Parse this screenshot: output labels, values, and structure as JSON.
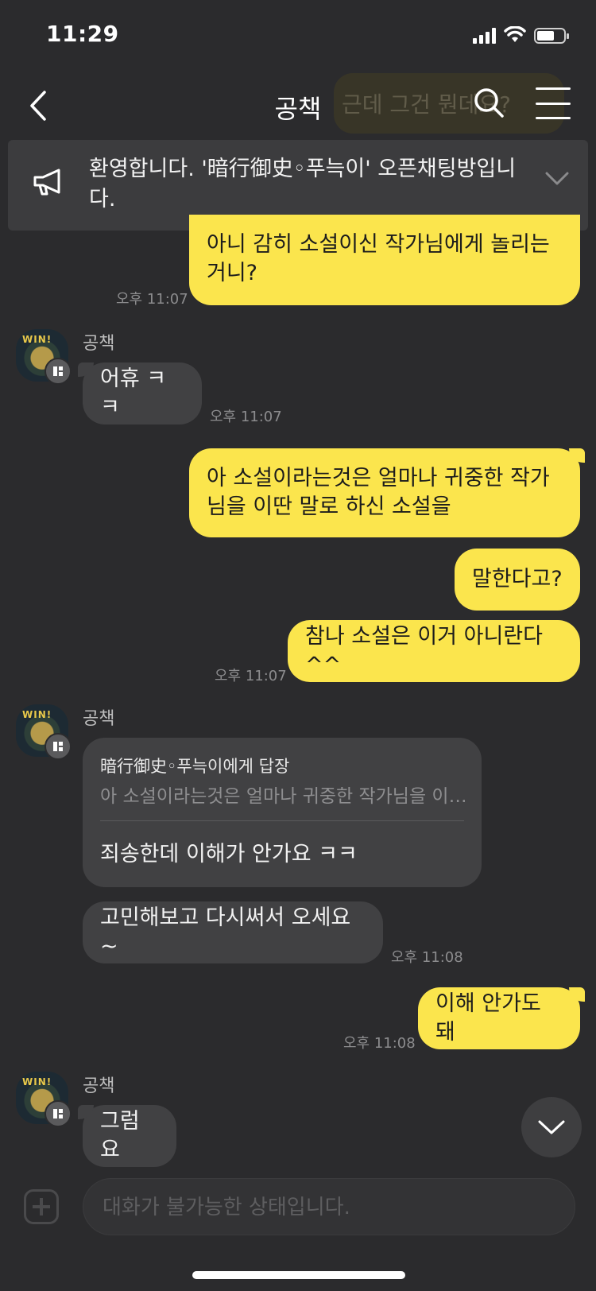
{
  "status_bar": {
    "time": "11:29",
    "battery_level": 0.65
  },
  "header": {
    "title": "공책",
    "ghost_preview": "근데 그건 뭔데요?"
  },
  "notice": {
    "text": "환영합니다. '暗行御史◦푸늑이' 오픈채팅방입니다."
  },
  "messages": {
    "m1": {
      "text": "아니 감히 소설이신 작가님에게 놀리는거니?",
      "time": "오후 11:07"
    },
    "m2": {
      "sender": "공책",
      "text": "어휴 ㅋㅋ",
      "time": "오후 11:07"
    },
    "m3": {
      "text": "아 소설이라는것은 얼마나 귀중한 작가님을 이딴 말로 하신 소설을"
    },
    "m4": {
      "text": "말한다고?"
    },
    "m5": {
      "text": "참나 소설은 이거 아니란다^^",
      "time": "오후 11:07"
    },
    "m6": {
      "sender": "공책",
      "reply_to": "暗行御史◦푸늑이에게 답장",
      "reply_quote": "아 소설이라는것은 얼마나 귀중한 작가님을 이…",
      "text": "죄송한데 이해가 안가요 ㅋㅋ"
    },
    "m7": {
      "text": "고민해보고 다시써서 오세요 ~",
      "time": "오후 11:08"
    },
    "m8": {
      "text": "이해 안가도 돼",
      "time": "오후 11:08"
    },
    "m9": {
      "sender": "공책",
      "text": "그럼요"
    }
  },
  "avatar": {
    "label": "WIN!"
  },
  "input": {
    "placeholder": "대화가 불가능한 상태입니다."
  },
  "colors": {
    "background": "#2b2b2d",
    "my_bubble": "#fbe54d",
    "their_bubble": "#414143"
  }
}
